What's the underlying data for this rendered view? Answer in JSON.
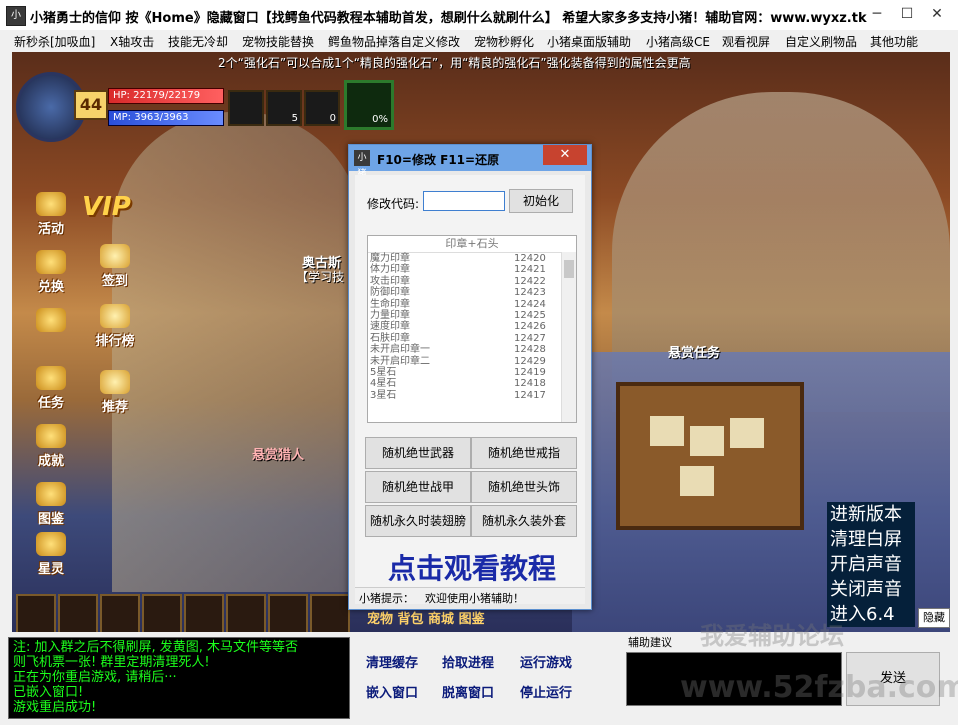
{
  "window": {
    "icon_text": "小猪",
    "title": "小猪勇士的信仰 按《Home》隐藏窗口【找鳄鱼代码教程本辅助首发，想刷什么就刷什么】 希望大家多多支持小猪！辅助官网：www.wyxz.tk",
    "min": "─",
    "max": "☐",
    "close": "✕"
  },
  "menu": [
    "新秒杀[加吸血]",
    "X轴攻击",
    "技能无冷却",
    "宠物技能替换",
    "鳄鱼物品掉落自定义修改",
    "宠物秒孵化",
    "小猪桌面版辅助",
    "小猪高级CE",
    "观看视屏",
    "自定义刷物品",
    "其他功能"
  ],
  "game": {
    "notice": "2个“强化石”可以合成1个“精良的强化石”，用“精良的强化石”强化装备得到的属性会更高",
    "level": "44",
    "hp": "HP: 22179/22179",
    "mp": "MP: 3963/3963",
    "slots": [
      "",
      "5",
      "0"
    ],
    "pet_pct": "0%",
    "vip": "VIP",
    "side_menu": [
      "活动",
      "兑换",
      "",
      "任务",
      "成就",
      "图鉴",
      "星灵"
    ],
    "side_menu2": [
      "签到",
      "排行榜",
      "推荐"
    ],
    "npc_name": "奥古斯",
    "npc_sub": "【学习技",
    "bounty_title": "悬赏任务",
    "bounty_npc": "悬赏猎人",
    "bottom_tabs": "宠物  背包  商城  图鉴",
    "right_overlay": [
      "进新版本",
      "清理白屏",
      "开启声音",
      "关闭声音",
      "进入6.4"
    ],
    "hide": "隐藏"
  },
  "dialog": {
    "icon_text": "小猪",
    "title": "F10=修改  F11=还原",
    "close": "✕",
    "code_label": "修改代码:",
    "code_value": "",
    "init_button": "初始化",
    "list_header": "印章+石头",
    "list": [
      {
        "name": "魔力印章",
        "code": "12420"
      },
      {
        "name": "体力印章",
        "code": "12421"
      },
      {
        "name": "攻击印章",
        "code": "12422"
      },
      {
        "name": "防御印章",
        "code": "12423"
      },
      {
        "name": "生命印章",
        "code": "12424"
      },
      {
        "name": "力量印章",
        "code": "12425"
      },
      {
        "name": "速度印章",
        "code": "12426"
      },
      {
        "name": "石肤印章",
        "code": "12427"
      },
      {
        "name": "未开启印章一",
        "code": "12428"
      },
      {
        "name": "未开启印章二",
        "code": "12429"
      },
      {
        "name": "5星石",
        "code": "12419"
      },
      {
        "name": "4星石",
        "code": "12418"
      },
      {
        "name": "3星石",
        "code": "12417"
      }
    ],
    "buttons": [
      "随机绝世武器",
      "随机绝世戒指",
      "随机绝世战甲",
      "随机绝世头饰",
      "随机永久时装翅膀",
      "随机永久装外套"
    ],
    "tutorial": "点击观看教程",
    "status_label": "小猪提示：",
    "status_text": "欢迎使用小猪辅助！"
  },
  "log": [
    "注: 加入群之后不得刷屏, 发黄图, 木马文件等等否",
    "则飞机票一张! 群里定期清理死人!",
    "正在为你重启游戏, 请稍后···",
    "已嵌入窗口!",
    "游戏重启成功!"
  ],
  "actions": [
    "清理缓存",
    "拾取进程",
    "运行游戏",
    "嵌入窗口",
    "脱离窗口",
    "停止运行"
  ],
  "advice_label": "辅助建议",
  "send": "发送",
  "watermarks": [
    "我爱辅助论坛",
    "www.52fzba.com"
  ],
  "colors": {
    "hp": "#d92a2a",
    "mp": "#2a4fd9",
    "log_text": "#1cff1c",
    "tutorial": "#1a2aa8",
    "dialog_title": "#6ea4e6"
  }
}
